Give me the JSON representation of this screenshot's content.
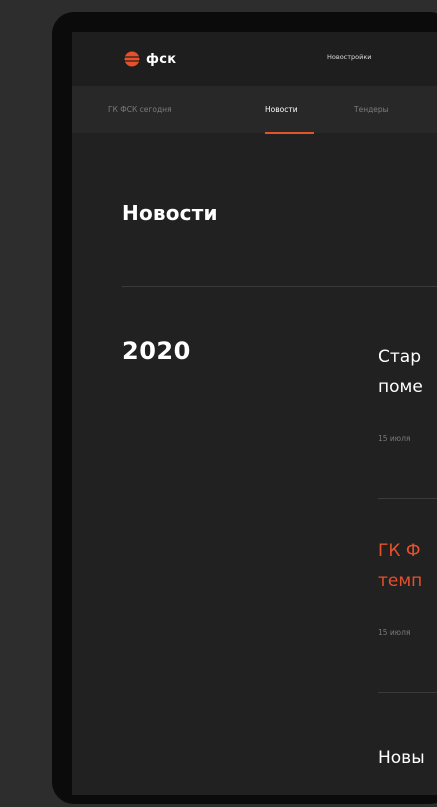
{
  "header": {
    "logo_text": "фск",
    "nav_item": "Новостройки"
  },
  "subnav": {
    "items": [
      {
        "label": "ГК ФСК сегодня"
      },
      {
        "label": "Новости"
      },
      {
        "label": "Тендеры"
      }
    ],
    "active": "Новости"
  },
  "main": {
    "title": "Новости",
    "year": "2020",
    "news": [
      {
        "title_line1": "Стар",
        "title_line2": "поме",
        "date": "15 июля",
        "highlighted": false
      },
      {
        "title_line1": "ГК Ф",
        "title_line2": "темп",
        "date": "15 июля",
        "highlighted": true
      },
      {
        "title_line1": "Новы",
        "title_line2": "",
        "date": "",
        "highlighted": false
      }
    ]
  },
  "colors": {
    "accent": "#e5512b",
    "background": "#212121",
    "frame": "#0b0b0b"
  }
}
